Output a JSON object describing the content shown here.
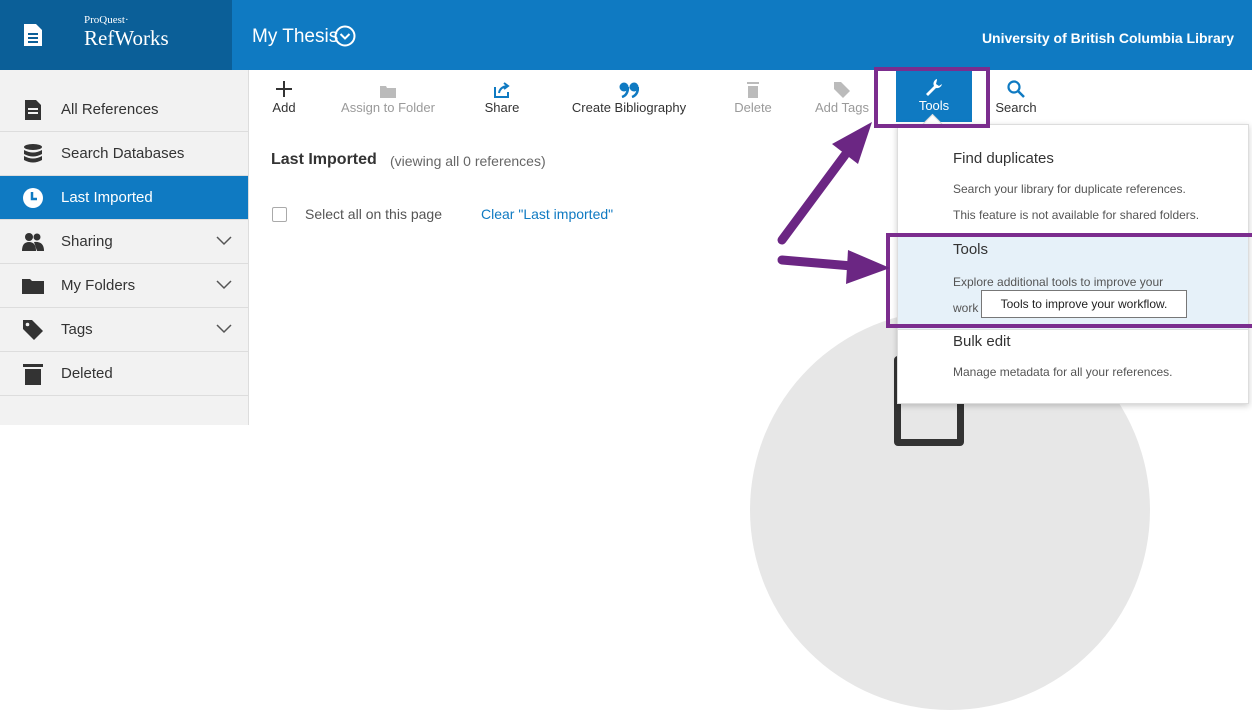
{
  "header": {
    "brand_small": "ProQuest·",
    "brand_name": "RefWorks",
    "project_title": "My Thesis",
    "library_name": "University of British Columbia Library"
  },
  "sidebar": {
    "items": [
      {
        "label": "All References",
        "icon": "document-icon"
      },
      {
        "label": "Search Databases",
        "icon": "database-icon"
      },
      {
        "label": "Last Imported",
        "icon": "clock-icon",
        "active": true
      },
      {
        "label": "Sharing",
        "icon": "people-icon"
      },
      {
        "label": "My Folders",
        "icon": "folder-icon"
      },
      {
        "label": "Tags",
        "icon": "tag-icon"
      },
      {
        "label": "Deleted",
        "icon": "trash-icon"
      }
    ]
  },
  "toolbar": {
    "add": "Add",
    "assign_folder": "Assign to Folder",
    "share": "Share",
    "create_bibliography": "Create Bibliography",
    "delete": "Delete",
    "add_tags": "Add Tags",
    "tools": "Tools",
    "search": "Search"
  },
  "content": {
    "title": "Last Imported",
    "subtitle": "(viewing all 0 references)",
    "select_all": "Select all on this page",
    "clear_link": "Clear \"Last imported\""
  },
  "dropdown": {
    "find_duplicates": {
      "title": "Find duplicates",
      "line1": "Search your library for duplicate references.",
      "line2": "This feature is not available for shared folders."
    },
    "tools": {
      "title": "Tools",
      "line1": "Explore additional tools to improve your",
      "line2": "work"
    },
    "bulk_edit": {
      "title": "Bulk edit",
      "line1": "Manage metadata for all your references."
    }
  },
  "tooltip": "Tools to improve your workflow.",
  "edge_text": ":",
  "colors": {
    "primary_blue": "#0f7ac2",
    "logo_blue": "#0b5f98",
    "annotation_purple": "#7b2d8e",
    "highlight_blue": "#e6f1f9"
  }
}
